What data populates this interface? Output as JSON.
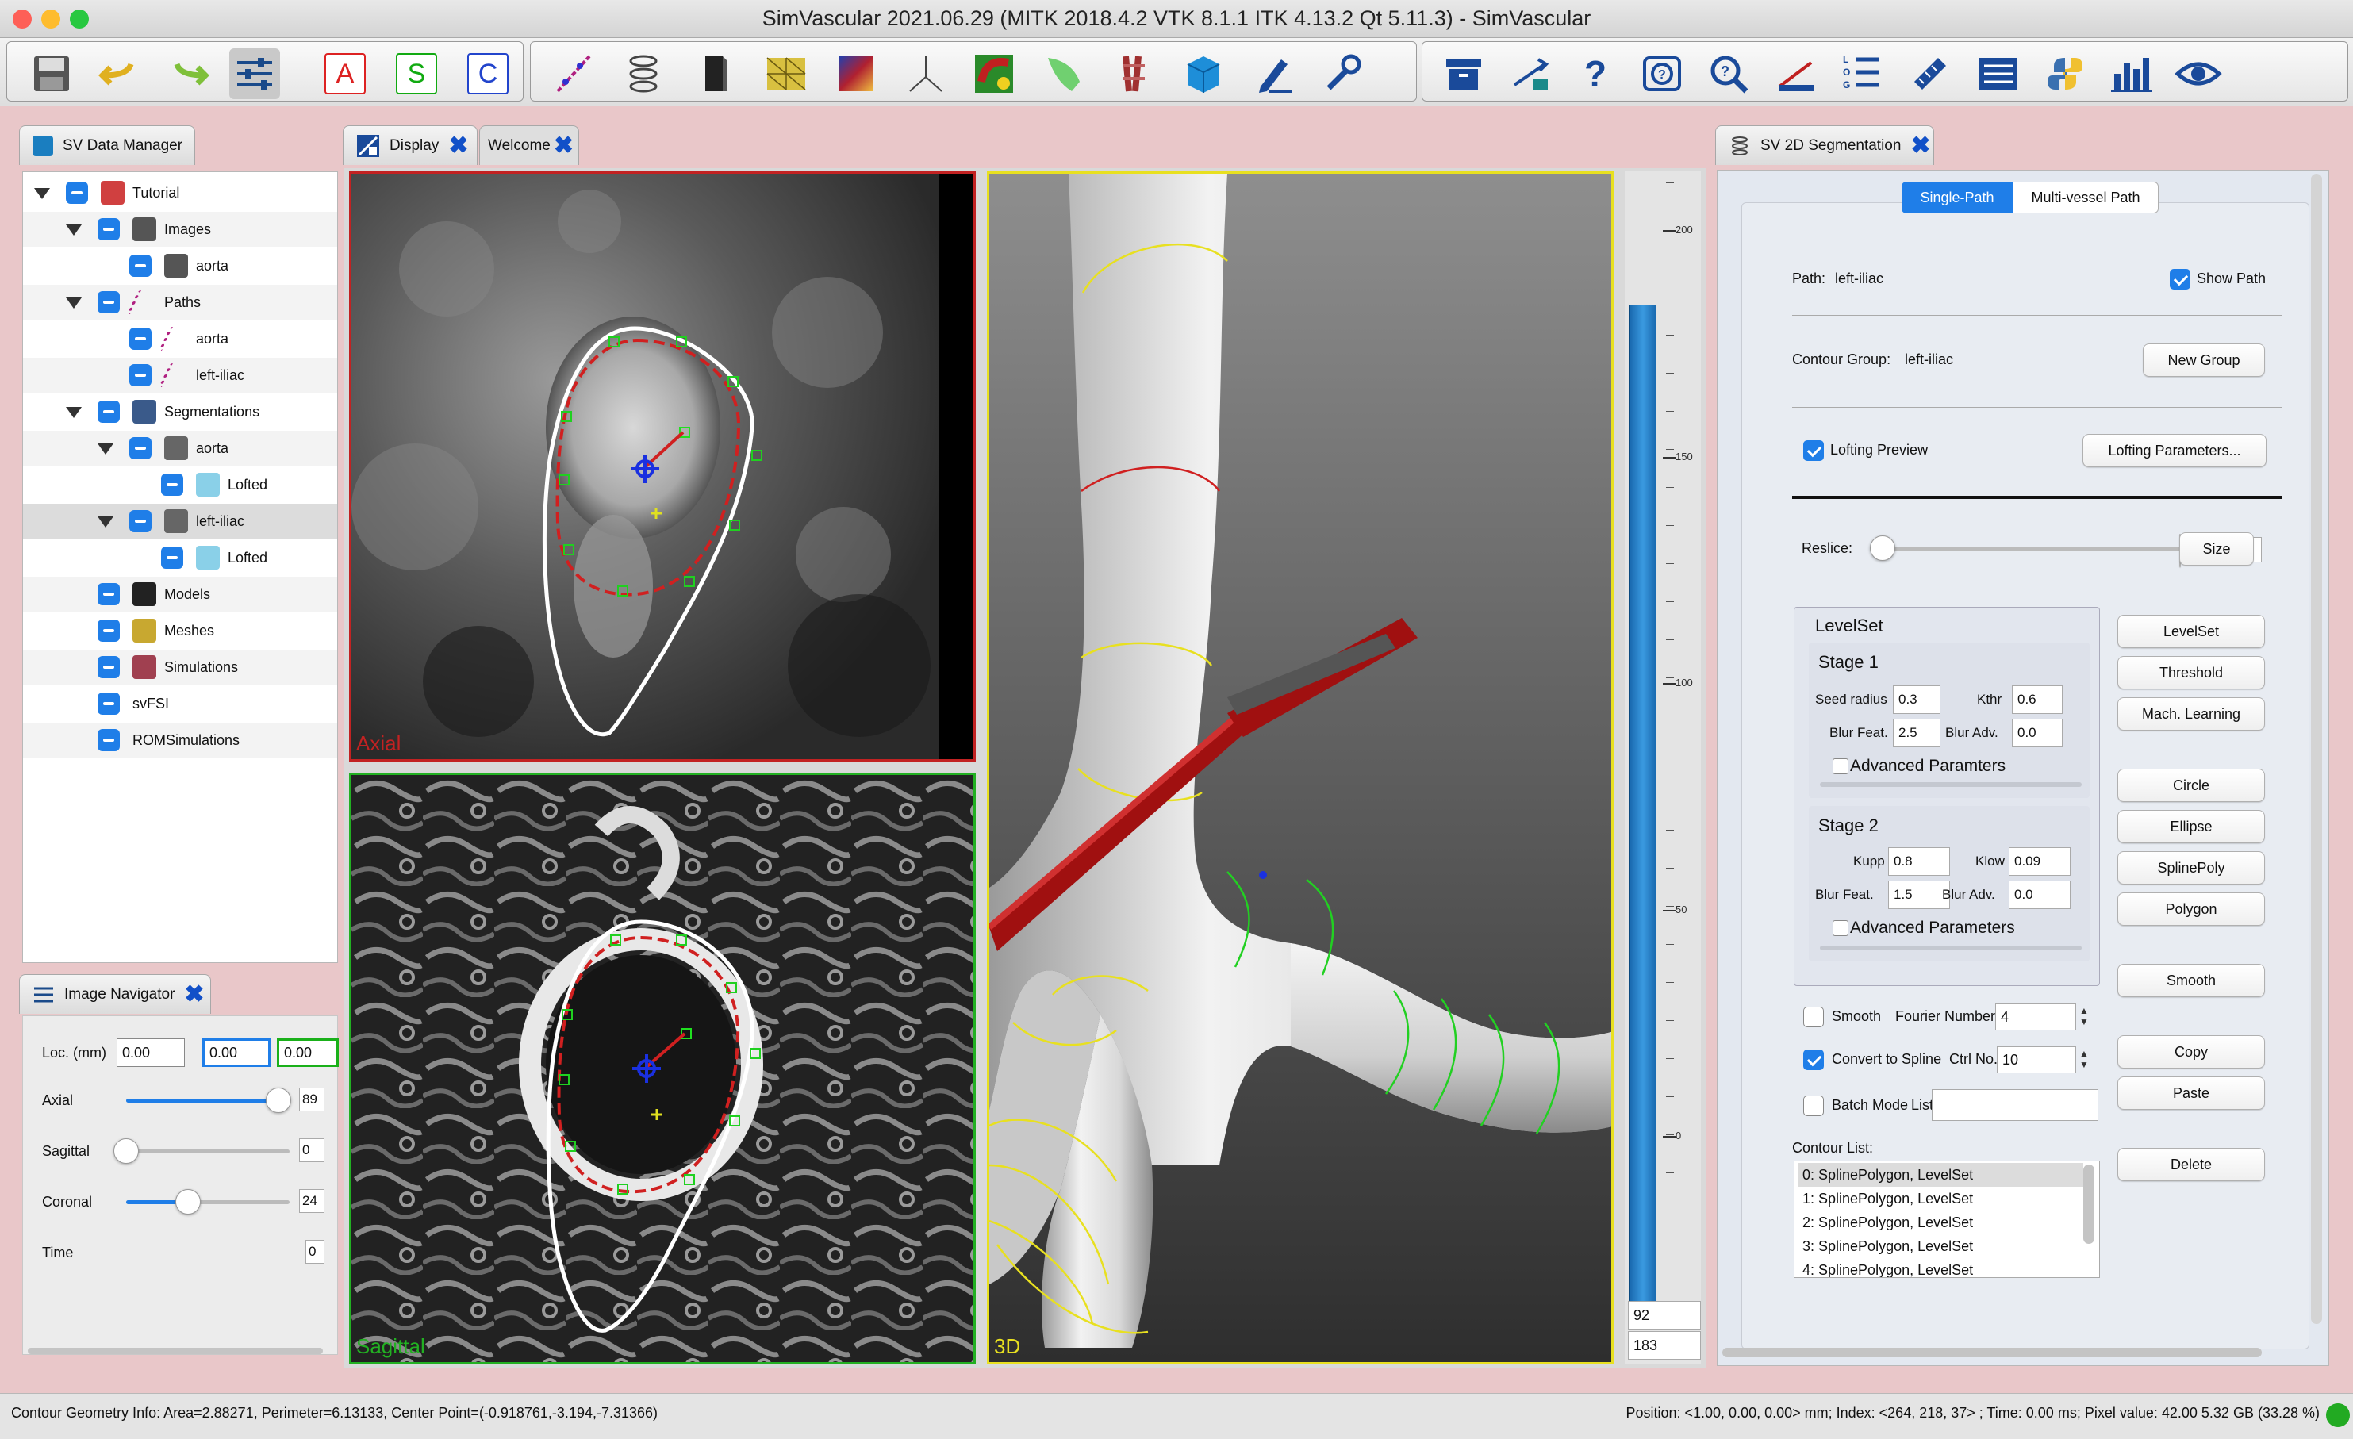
{
  "window": {
    "title": "SimVascular 2021.06.29 (MITK 2018.4.2 VTK 8.1.1 ITK 4.13.2 Qt 5.11.3) - SimVascular"
  },
  "toolbar": {
    "letters": {
      "a": "A",
      "s": "S",
      "c": "C"
    },
    "icons": [
      "save-icon",
      "undo-icon",
      "redo-icon",
      "settings-sliders-icon",
      "a-icon",
      "s-icon",
      "c-icon",
      "path-icon",
      "segmentation-icon",
      "model-icon",
      "mesh-icon",
      "simulation-icon",
      "svfsi-icon",
      "rom-icon",
      "tool-icon",
      "tool2-icon",
      "cube-icon",
      "edit-icon",
      "wrench-icon",
      "archive-icon",
      "transfer-icon",
      "help-icon",
      "help-box-icon",
      "search-help-icon",
      "measure-icon",
      "log-icon",
      "ruler-icon",
      "list-icon",
      "python-icon",
      "chart-icon",
      "eye-icon"
    ]
  },
  "data_manager": {
    "tab_label": "SV Data Manager",
    "tree": [
      {
        "label": "Tutorial"
      },
      {
        "label": "Images"
      },
      {
        "label": "aorta"
      },
      {
        "label": "Paths"
      },
      {
        "label": "aorta"
      },
      {
        "label": "left-iliac"
      },
      {
        "label": "Segmentations"
      },
      {
        "label": "aorta"
      },
      {
        "label": "Lofted"
      },
      {
        "label": "left-iliac"
      },
      {
        "label": "Lofted"
      },
      {
        "label": "Models"
      },
      {
        "label": "Meshes"
      },
      {
        "label": "Simulations"
      },
      {
        "label": "svFSI"
      },
      {
        "label": "ROMSimulations"
      }
    ]
  },
  "image_navigator": {
    "tab_label": "Image Navigator",
    "loc_label": "Loc. (mm)",
    "loc_values": [
      "0.00",
      "0.00",
      "0.00"
    ],
    "axial": {
      "label": "Axial",
      "value": "89",
      "fraction": 0.93
    },
    "sagittal": {
      "label": "Sagittal",
      "value": "0",
      "fraction": 0.0
    },
    "coronal": {
      "label": "Coronal",
      "value": "24",
      "fraction": 0.38
    },
    "time": {
      "label": "Time",
      "value": "0"
    }
  },
  "display": {
    "tab_display": "Display",
    "tab_welcome": "Welcome",
    "view_axial": "Axial",
    "view_sagittal": "Sagittal",
    "view_3d": "3D",
    "ruler_ticks": [
      "200",
      "150",
      "100",
      "50",
      "0"
    ],
    "level_values": [
      "92",
      "183"
    ]
  },
  "segmentation": {
    "tab_label": "SV 2D Segmentation",
    "mode_tabs": [
      "Single-Path",
      "Multi-vessel Path"
    ],
    "path_label": "Path:",
    "path_value": "left-iliac",
    "show_path": "Show Path",
    "contour_group_label": "Contour Group:",
    "contour_group_value": "left-iliac",
    "new_group": "New Group",
    "lofting_preview": "Lofting Preview",
    "lofting_params": "Lofting Parameters...",
    "reslice_label": "Reslice:",
    "reslice_value": "0",
    "size_btn": "Size",
    "levelset": {
      "title": "LevelSet",
      "stage1": "Stage 1",
      "seed_radius_label": "Seed radius",
      "seed_radius": "0.3",
      "kthr_label": "Kthr",
      "kthr": "0.6",
      "blur_feat_label": "Blur Feat.",
      "blur_feat1": "2.5",
      "blur_adv_label": "Blur Adv.",
      "blur_adv1": "0.0",
      "adv1": "Advanced  Paramters",
      "stage2": "Stage 2",
      "kupp_label": "Kupp",
      "kupp": "0.8",
      "klow_label": "Klow",
      "klow": "0.09",
      "blur_feat2": "1.5",
      "blur_adv2": "0.0",
      "adv2": "Advanced Parameters"
    },
    "method_buttons": [
      "LevelSet",
      "Threshold",
      "Mach. Learning",
      "Circle",
      "Ellipse",
      "SplinePoly",
      "Polygon",
      "Smooth",
      "Copy",
      "Paste",
      "Delete"
    ],
    "smooth_label": "Smooth",
    "fourier_label": "Fourier Number",
    "fourier_value": "4",
    "convert_label": "Convert to Spline",
    "ctrl_label": "Ctrl No.",
    "ctrl_value": "10",
    "batch_label": "Batch Mode",
    "list_label": "List",
    "contour_list_label": "Contour List:",
    "contour_list": [
      "0: SplinePolygon, LevelSet",
      "1: SplinePolygon, LevelSet",
      "2: SplinePolygon, LevelSet",
      "3: SplinePolygon, LevelSet",
      "4: SplinePolygon, LevelSet"
    ]
  },
  "status": {
    "left": "Contour Geometry Info: Area=2.88271, Perimeter=6.13133, Center Point=(-0.918761,-3.194,-7.31366)",
    "right": "Position: <1.00, 0.00, 0.00> mm; Index: <264, 218, 37> ; Time: 0.00 ms; Pixel value: 42.00   5.32 GB (33.28 %)"
  },
  "colors": {
    "accent": "#1f7ee8",
    "axial_border": "#c22222",
    "sagittal_border": "#22b022",
    "view3d_border": "#e8e020",
    "status_ok": "#22aa22"
  }
}
